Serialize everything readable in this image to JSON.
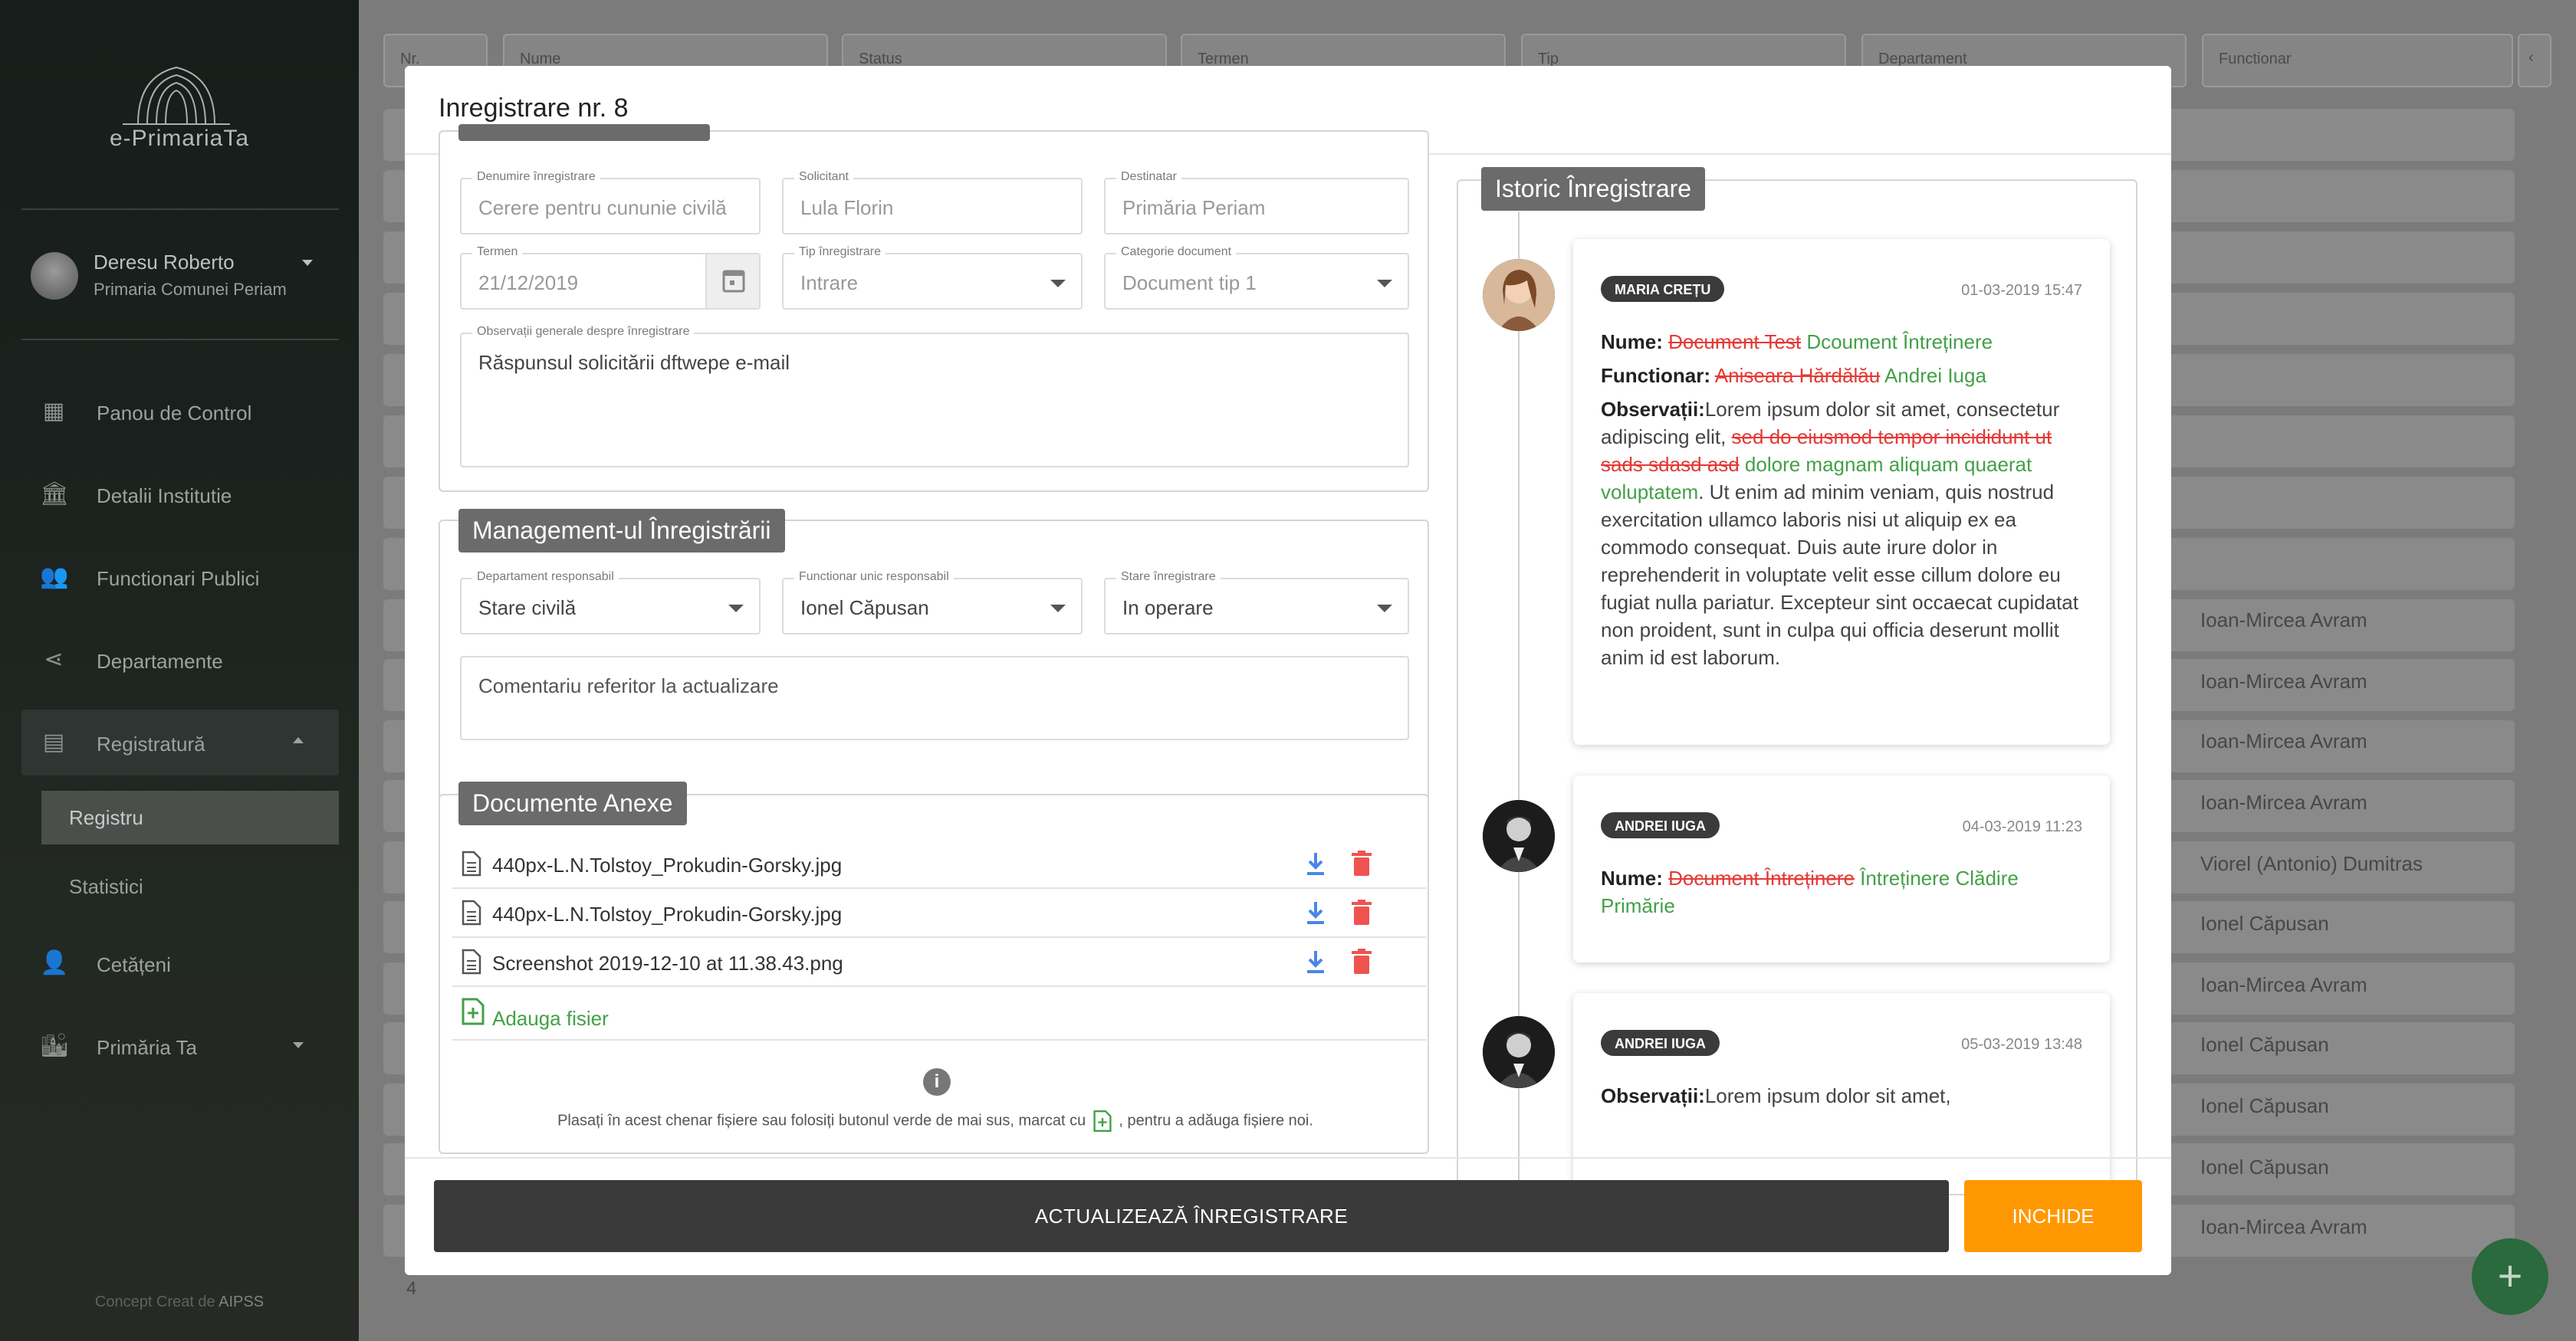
{
  "app": {
    "name": "e-PrimariaTa",
    "footer_prefix": "Concept Creat de",
    "footer_brand": "AIPSS"
  },
  "user": {
    "name": "Deresu Roberto",
    "org": "Primaria Comunei Periam"
  },
  "nav": [
    {
      "label": "Panou de Control",
      "icon": "dashboard-icon"
    },
    {
      "label": "Detalii Institutie",
      "icon": "institution-icon"
    },
    {
      "label": "Functionari Publici",
      "icon": "people-icon"
    },
    {
      "label": "Departamente",
      "icon": "share-icon"
    },
    {
      "label": "Registratură",
      "icon": "register-icon"
    },
    {
      "label": "Cetățeni",
      "icon": "citizens-icon"
    },
    {
      "label": "Primăria Ta",
      "icon": "city-icon"
    }
  ],
  "subnav": [
    "Registru",
    "Statistici"
  ],
  "bg": {
    "filters": [
      "Nr.",
      "Nume",
      "Status",
      "Termen",
      "Tip",
      "Departament",
      "Functionar"
    ],
    "names": [
      "Ioan-Mircea Avram",
      "Ioan-Mircea Avram",
      "Ioan-Mircea Avram",
      "Ioan-Mircea Avram",
      "Viorel (Antonio) Dumitras",
      "Ionel Căpusan",
      "Ioan-Mircea Avram",
      "Ionel Căpusan",
      "Ionel Căpusan",
      "Ionel Căpusan",
      "Ioan-Mircea Avram"
    ],
    "page_num": "4"
  },
  "modal": {
    "title": "Inregistrare nr. 8",
    "details": {
      "denumire_label": "Denumire înregistrare",
      "denumire_value": "Cerere pentru cununie civilă",
      "solicitant_label": "Solicitant",
      "solicitant_value": "Lula Florin",
      "destinatar_label": "Destinatar",
      "destinatar_value": "Primăria Periam",
      "termen_label": "Termen",
      "termen_value": "21/12/2019",
      "tip_label": "Tip înregistrare",
      "tip_value": "Intrare",
      "categorie_label": "Categorie document",
      "categorie_value": "Document tip 1",
      "observatii_label": "Observații generale despre înregistrare",
      "observatii_value": "Răspunsul solicitării dftwepe e-mail"
    },
    "management": {
      "title": "Management-ul Înregistrării",
      "dept_label": "Departament responsabil",
      "dept_value": "Stare civilă",
      "func_label": "Functionar unic responsabil",
      "func_value": "Ionel Căpusan",
      "stare_label": "Stare înregistrare",
      "stare_value": "In operare",
      "comment_placeholder": "Comentariu referitor la actualizare"
    },
    "documents": {
      "title": "Documente Anexe",
      "files": [
        "440px-L.N.Tolstoy_Prokudin-Gorsky.jpg",
        "440px-L.N.Tolstoy_Prokudin-Gorsky.jpg",
        "Screenshot 2019-12-10 at 11.38.43.png"
      ],
      "add_label": "Adauga fisier",
      "hint_before": "Plasați în acest chenar fișiere sau folosiți butonul verde de mai sus, marcat cu",
      "hint_after": ", pentru a adăuga fișiere noi."
    },
    "history": {
      "title": "Istoric Înregistrare",
      "entries": [
        {
          "author": "MARIA CREȚU",
          "date": "01-03-2019 15:47",
          "nume_label": "Nume:",
          "nume_old": "Document Test",
          "nume_new": "Dcoument Întreținere",
          "func_label": "Functionar:",
          "func_old": "Aniseara Hărdălău",
          "func_new": "Andrei Iuga",
          "obs_label": "Observații:",
          "obs_text1": "Lorem ipsum dolor sit amet, consectetur adipiscing elit,",
          "obs_old": "sed do eiusmod tempor incididunt ut sads sdasd asd",
          "obs_new": "dolore magnam aliquam quaerat voluptatem",
          "obs_text2": ". Ut enim ad minim veniam, quis nostrud exercitation ullamco laboris nisi ut aliquip ex ea commodo consequat. Duis aute irure dolor in reprehenderit in voluptate velit esse cillum dolore eu fugiat nulla pariatur. Excepteur sint occaecat cupidatat non proident, sunt in culpa qui officia deserunt mollit anim id est laborum."
        },
        {
          "author": "ANDREI IUGA",
          "date": "04-03-2019 11:23",
          "nume_label": "Nume:",
          "nume_old": "Document Întreținere",
          "nume_new": "Întreținere Clădire Primărie"
        },
        {
          "author": "ANDREI IUGA",
          "date": "05-03-2019 13:48",
          "obs_label": "Observații:",
          "obs_text1": "Lorem ipsum dolor sit amet,"
        }
      ]
    },
    "buttons": {
      "update": "ACTUALIZEAZĂ ÎNREGISTRARE",
      "close": "INCHIDE"
    }
  },
  "colors": {
    "accent": "#ff9800",
    "dark": "#3a3a3a",
    "old": "#e53935",
    "new": "#43a047",
    "download": "#4a86e8"
  }
}
